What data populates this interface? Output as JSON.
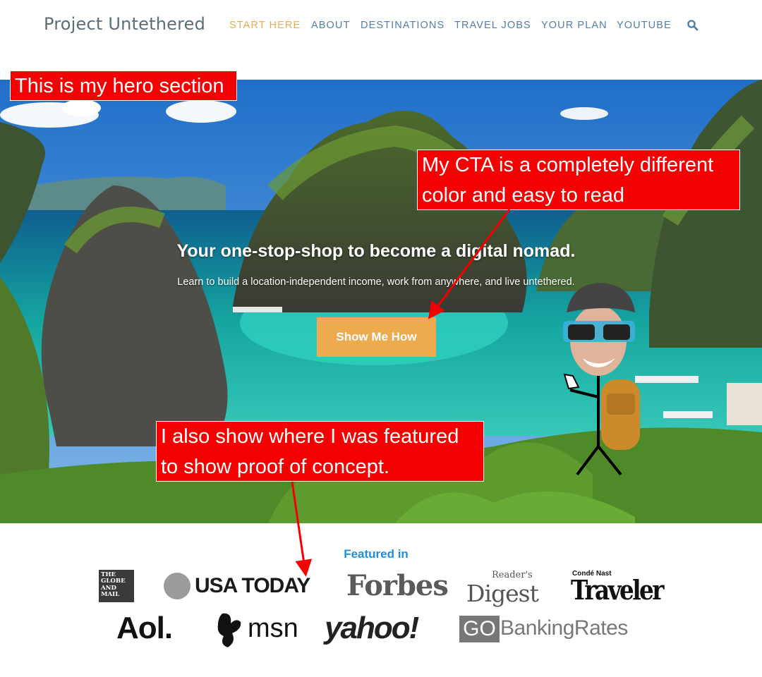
{
  "header": {
    "logo": "Project Untethered",
    "nav": [
      {
        "label": "START HERE",
        "active": true
      },
      {
        "label": "ABOUT",
        "active": false
      },
      {
        "label": "DESTINATIONS",
        "active": false
      },
      {
        "label": "TRAVEL JOBS",
        "active": false
      },
      {
        "label": "YOUR PLAN",
        "active": false
      },
      {
        "label": "YOUTUBE",
        "active": false
      }
    ],
    "search_icon": "search-icon"
  },
  "hero": {
    "title": "Your one-stop-shop to become a digital nomad.",
    "subtitle": "Learn to build a location-independent income, work from anywhere, and live untethered.",
    "cta_label": "Show Me How"
  },
  "annotations": {
    "hero_note": "This is my hero section",
    "cta_note_line1": "My CTA is a completely different",
    "cta_note_line2": "color and easy to read",
    "featured_note_line1": "I also show where I was featured",
    "featured_note_line2": "to show proof of concept."
  },
  "featured": {
    "title": "Featured in",
    "globe_line1": "THE",
    "globe_line2": "GLOBE",
    "globe_line3": "AND",
    "globe_line4": "MAIL",
    "usa_today": "USA TODAY",
    "forbes": "Forbes",
    "readers_top": "Reader's",
    "readers_bottom": "Digest",
    "traveler_top": "Condé Nast",
    "traveler_bottom": "Traveler",
    "aol": "Aol.",
    "msn": "msn",
    "yahoo": "yahoo!",
    "go": "GO",
    "banking_rates": "BankingRates"
  },
  "colors": {
    "nav_link": "#4f7fad",
    "nav_active": "#eeab4d",
    "cta": "#eeab4d",
    "annotation": "#f50000",
    "featured_title": "#1c8fe0"
  }
}
